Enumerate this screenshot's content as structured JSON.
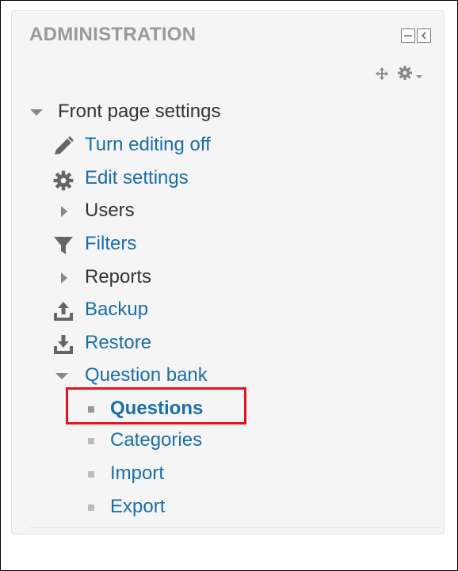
{
  "block": {
    "title": "ADMINISTRATION",
    "controls": [
      "minus-square-icon",
      "collapse-left-icon",
      "move-icon",
      "gear-icon",
      "caret-down-icon"
    ]
  },
  "tree": {
    "root": {
      "label": "Front page settings",
      "icon": "caret-down-icon"
    },
    "items": [
      {
        "label": "Turn editing off",
        "icon": "pencil-icon"
      },
      {
        "label": "Edit settings",
        "icon": "gear-icon"
      },
      {
        "label": "Users",
        "icon": "caret-right-icon"
      },
      {
        "label": "Filters",
        "icon": "funnel-icon"
      },
      {
        "label": "Reports",
        "icon": "caret-right-icon"
      },
      {
        "label": "Backup",
        "icon": "upload-icon"
      },
      {
        "label": "Restore",
        "icon": "download-icon"
      },
      {
        "label": "Question bank",
        "icon": "caret-down-icon"
      }
    ],
    "question_bank": [
      {
        "label": "Questions",
        "icon": "bullet-icon",
        "active": true
      },
      {
        "label": "Categories",
        "icon": "bullet-icon"
      },
      {
        "label": "Import",
        "icon": "bullet-icon"
      },
      {
        "label": "Export",
        "icon": "bullet-icon"
      }
    ]
  },
  "colors": {
    "link": "#1a6ea8",
    "text": "#333333",
    "title": "#999999",
    "icon": "#666666",
    "highlight": "#e8111d",
    "block_bg": "#f5f5f5"
  }
}
